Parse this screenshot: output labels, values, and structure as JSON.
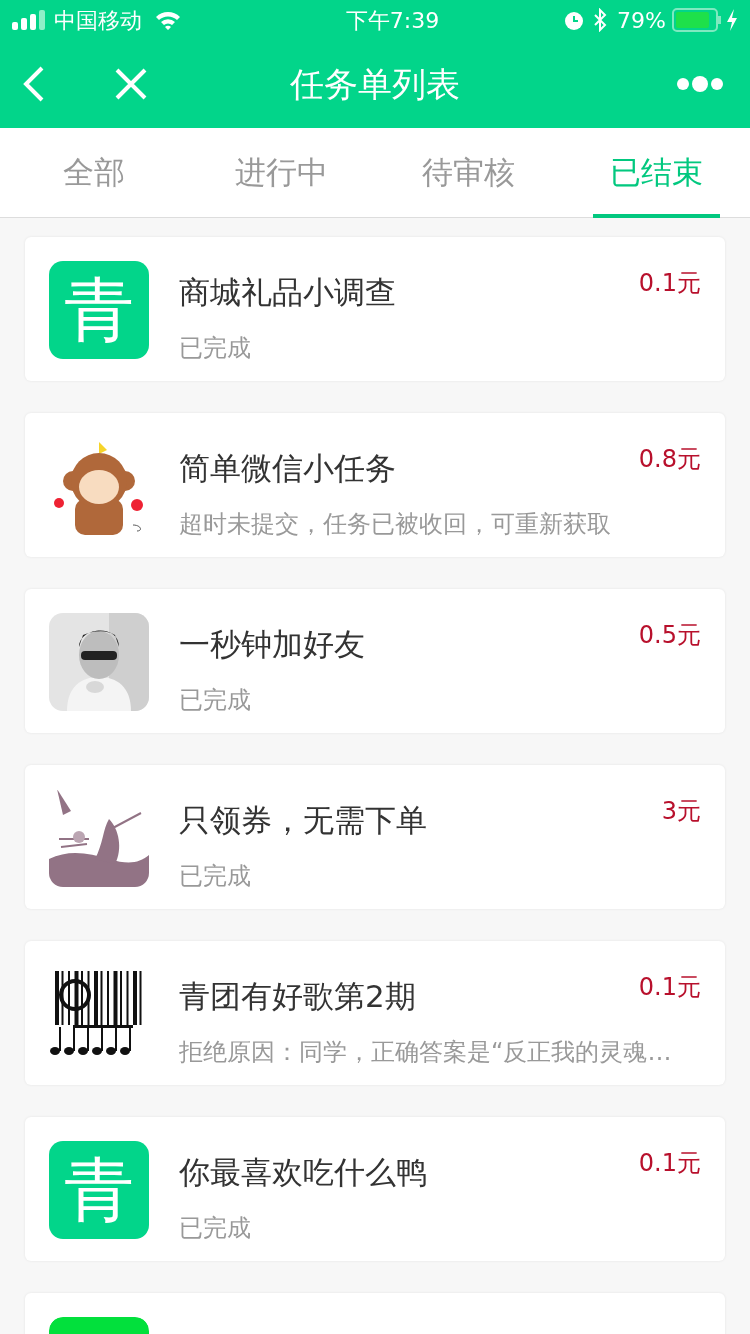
{
  "status_bar": {
    "carrier": "中国移动",
    "time": "下午7:39",
    "battery": "79%"
  },
  "nav": {
    "title": "任务单列表"
  },
  "tabs": [
    {
      "label": "全部",
      "selected": false
    },
    {
      "label": "进行中",
      "selected": false
    },
    {
      "label": "待审核",
      "selected": false
    },
    {
      "label": "已结束",
      "selected": true
    }
  ],
  "tasks": [
    {
      "thumb": {
        "kind": "logo",
        "glyph": "青"
      },
      "title": "商城礼品小调查",
      "status": "已完成",
      "price": "0.1元"
    },
    {
      "thumb": {
        "kind": "cartoon"
      },
      "title": "简单微信小任务",
      "status": "超时未提交，任务已被收回，可重新获取",
      "price": "0.8元"
    },
    {
      "title": "一秒钟加好友",
      "status": "已完成",
      "price": "0.5元"
    },
    {
      "thumb": {
        "kind": "sketch"
      },
      "title": "只领券，无需下单",
      "status": "已完成",
      "price": "3元"
    },
    {
      "thumb": {
        "kind": "music"
      },
      "title": "青团有好歌第2期",
      "status": "拒绝原因：同学，正确答案是“反正我的灵魂…",
      "price": "0.1元"
    },
    {
      "thumb": {
        "kind": "logo",
        "glyph": "青"
      },
      "title": "你最喜欢吃什么鸭",
      "status": "已完成",
      "price": "0.1元"
    },
    {
      "thumb": {
        "kind": "plain"
      }
    }
  ]
}
